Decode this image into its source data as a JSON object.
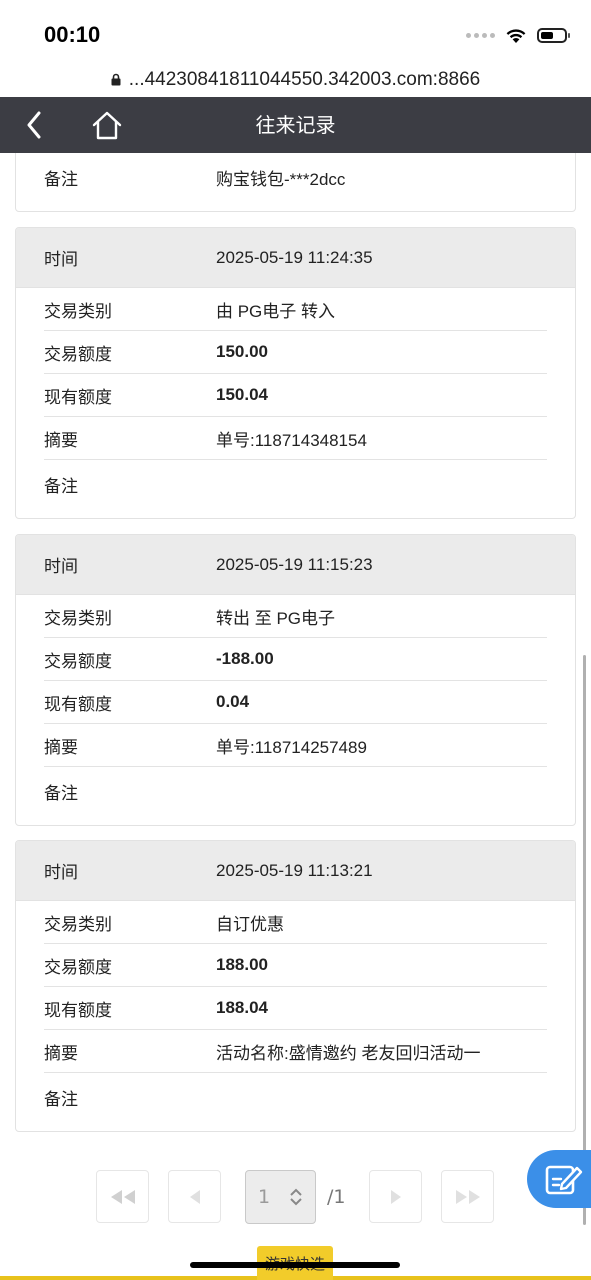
{
  "status": {
    "time": "00:10"
  },
  "browser": {
    "url": "...44230841811044550.342003.com:8866"
  },
  "header": {
    "title": "往来记录"
  },
  "partial_card": {
    "label": "备注",
    "value": "购宝钱包-***2dcc"
  },
  "labels": {
    "time": "时间",
    "type": "交易类别",
    "amount": "交易额度",
    "balance": "现有额度",
    "summary": "摘要",
    "remark": "备注"
  },
  "records": [
    {
      "time": "2025-05-19 11:24:35",
      "type": "由 PG电子 转入",
      "amount": "150.00",
      "balance": "150.04",
      "summary": "单号:118714348154",
      "remark": ""
    },
    {
      "time": "2025-05-19 11:15:23",
      "type": "转出 至 PG电子",
      "amount": "-188.00",
      "balance": "0.04",
      "summary": "单号:118714257489",
      "remark": ""
    },
    {
      "time": "2025-05-19 11:13:21",
      "type": "自订优惠",
      "amount": "188.00",
      "balance": "188.04",
      "summary": "活动名称:盛情邀约 老友回归活动一",
      "remark": ""
    }
  ],
  "pagination": {
    "current": "1",
    "total": "/1"
  },
  "bottom": {
    "quick_tab": "游戏快选"
  },
  "icons": {
    "back": "chevron-left-icon",
    "home": "home-icon",
    "edit": "edit-icon",
    "first": "first-page-icon",
    "prev": "prev-page-icon",
    "next": "next-page-icon",
    "last": "last-page-icon"
  },
  "colors": {
    "header_bg": "#3c3d44",
    "card_head_bg": "#ebebeb",
    "fab_bg": "#3b8fe8",
    "accent_yellow": "#f2cc2a"
  }
}
